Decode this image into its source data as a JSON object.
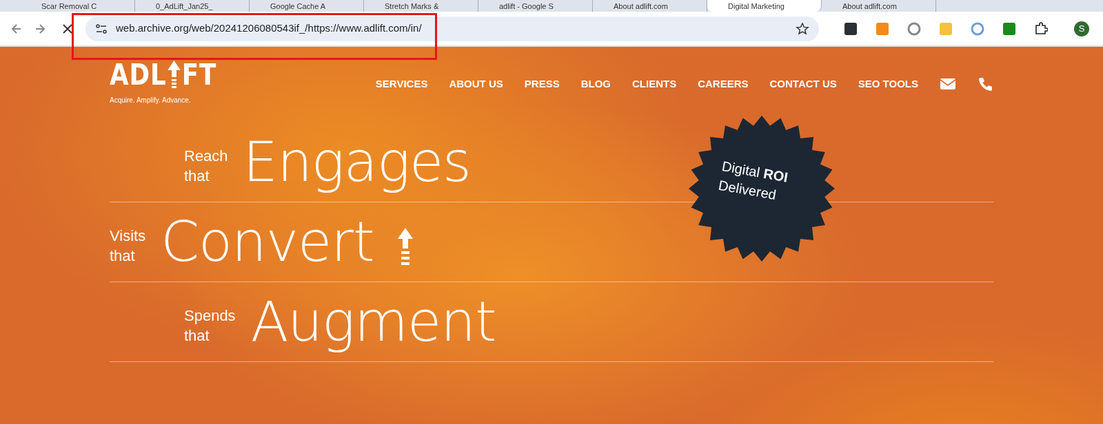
{
  "browser": {
    "tabs": [
      {
        "title": "Scar Removal C",
        "selected": false
      },
      {
        "title": "0_AdLift_Jan25_",
        "selected": false
      },
      {
        "title": "Google Cache A",
        "selected": false
      },
      {
        "title": "Stretch Marks &",
        "selected": false
      },
      {
        "title": "adlift - Google S",
        "selected": false
      },
      {
        "title": "About adlift.com",
        "selected": false
      },
      {
        "title": "Digital Marketing",
        "selected": true
      },
      {
        "title": "About adlift.com",
        "selected": false
      }
    ],
    "url": "web.archive.org/web/20241206080543if_/https://www.adlift.com/in/",
    "url_highlighted": true,
    "profile_initial": "S"
  },
  "site": {
    "logo_left": "ADL",
    "logo_right": "FT",
    "tagline": "Acquire. Amplify. Advance.",
    "nav": [
      "SERVICES",
      "ABOUT US",
      "PRESS",
      "BLOG",
      "CLIENTS",
      "CAREERS",
      "CONTACT US",
      "SEO TOOLS"
    ]
  },
  "hero": {
    "rows": [
      {
        "small": [
          "Reach",
          "that"
        ],
        "big": "Engages",
        "arrow": false,
        "indent": true
      },
      {
        "small": [
          "Visits",
          "that"
        ],
        "big": "Convert",
        "arrow": true,
        "indent": false
      },
      {
        "small": [
          "Spends",
          "that"
        ],
        "big": "Augment",
        "arrow": false,
        "indent": true
      }
    ],
    "badge": [
      "Digital **ROI**",
      "Delivered"
    ]
  }
}
